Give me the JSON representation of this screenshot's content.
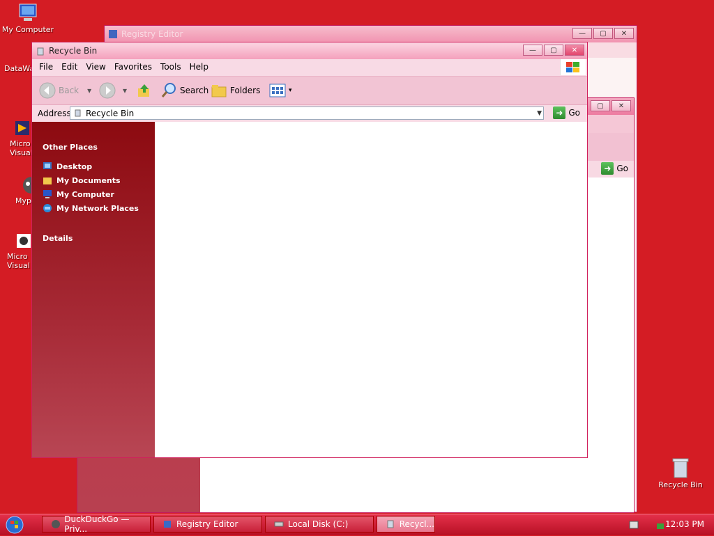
{
  "desktop": {
    "icons": [
      {
        "label": "My Computer"
      },
      {
        "label": "DataWa"
      },
      {
        "label": "Micro Visual"
      },
      {
        "label": "Myp"
      },
      {
        "label": "Micro Visual"
      },
      {
        "label": "Recycle Bin"
      }
    ]
  },
  "registry_editor": {
    "title": "Registry Editor"
  },
  "local_disk": {
    "go_label": "Go"
  },
  "recycle_window": {
    "title": "Recycle Bin",
    "menu": [
      "File",
      "Edit",
      "View",
      "Favorites",
      "Tools",
      "Help"
    ],
    "toolbar": {
      "back": "Back",
      "search": "Search",
      "folders": "Folders"
    },
    "address": {
      "label": "Address",
      "value": "Recycle Bin",
      "go": "Go"
    },
    "sidebar": {
      "other_places_title": "Other Places",
      "items": [
        "Desktop",
        "My Documents",
        "My Computer",
        "My Network Places"
      ],
      "details_title": "Details"
    }
  },
  "taskbar": {
    "tasks": [
      "DuckDuckGo — Priv...",
      "Registry Editor",
      "Local Disk (C:)",
      "Recycl..."
    ],
    "clock": "12:03 PM"
  },
  "colors": {
    "desktop": "#d41c24",
    "accent": "#f06c98"
  }
}
